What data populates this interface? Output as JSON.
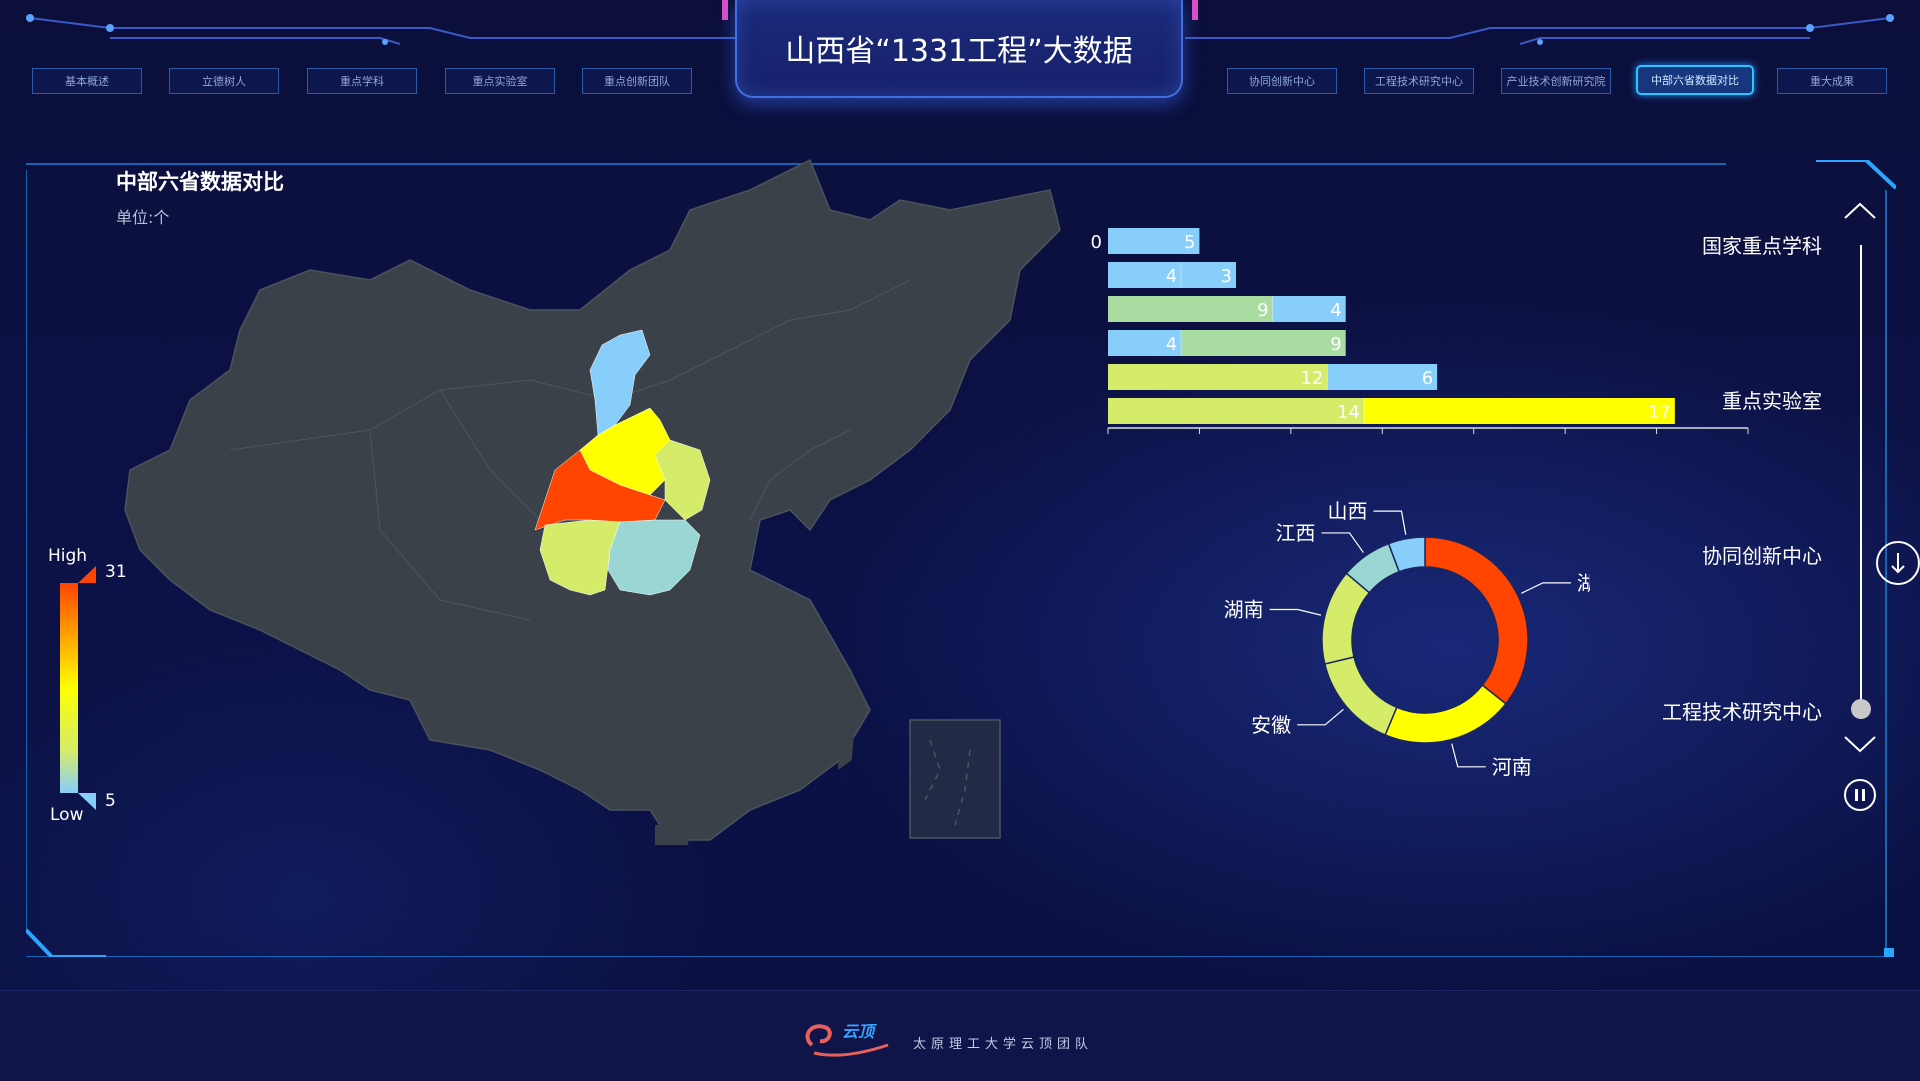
{
  "header": {
    "title": "山西省“1331工程”大数据",
    "nav_left": [
      "基本概述",
      "立德树人",
      "重点学科",
      "重点实验室",
      "重点创新团队"
    ],
    "nav_right": [
      "协同创新中心",
      "工程技术研究中心",
      "产业技术创新研究院",
      "中部六省数据对比",
      "重大成果"
    ],
    "active_tab": "中部六省数据对比"
  },
  "panel": {
    "title": "中部六省数据对比",
    "unit": "单位:个"
  },
  "map": {
    "legend": {
      "high_label": "High",
      "low_label": "Low",
      "max": "31",
      "min": "5"
    },
    "provinces": [
      {
        "name": "山西",
        "color": "#87cefa"
      },
      {
        "name": "河南",
        "color": "#ffff00"
      },
      {
        "name": "湖北",
        "color": "#ff4500"
      },
      {
        "name": "安徽",
        "color": "#d4ec6a"
      },
      {
        "name": "湖南",
        "color": "#d4ec6a"
      },
      {
        "name": "江西",
        "color": "#99d6d4"
      }
    ]
  },
  "side_nav": {
    "items": [
      "国家重点学科",
      "重点实验室",
      "协同创新中心",
      "工程技术研究中心"
    ],
    "active_index": 3
  },
  "chart_data": [
    {
      "type": "bar",
      "orientation": "horizontal",
      "stacked": true,
      "rows": [
        {
          "a": 0,
          "b": 5,
          "color_a": "#87cefa",
          "color_b": "#87cefa"
        },
        {
          "a": 4,
          "b": 3,
          "color_a": "#87cefa",
          "color_b": "#87cefa"
        },
        {
          "a": 9,
          "b": 4,
          "color_a": "#a8dca0",
          "color_b": "#87cefa"
        },
        {
          "a": 4,
          "b": 9,
          "color_a": "#87cefa",
          "color_b": "#a8dca0"
        },
        {
          "a": 12,
          "b": 6,
          "color_a": "#d4ec6a",
          "color_b": "#87cefa"
        },
        {
          "a": 14,
          "b": 17,
          "color_a": "#d4ec6a",
          "color_b": "#ffff00"
        }
      ],
      "xlim": [
        0,
        35
      ]
    },
    {
      "type": "pie",
      "donut": true,
      "slices": [
        {
          "label": "湖北",
          "value": 31,
          "color": "#ff4500"
        },
        {
          "label": "河南",
          "value": 18,
          "color": "#ffff00"
        },
        {
          "label": "安徽",
          "value": 13,
          "color": "#d4ec6a"
        },
        {
          "label": "湖南",
          "value": 13,
          "color": "#d4ec6a"
        },
        {
          "label": "江西",
          "value": 7,
          "color": "#99d6d4"
        },
        {
          "label": "山西",
          "value": 5,
          "color": "#87cefa"
        }
      ]
    }
  ],
  "footer": {
    "logo_text": "云顶",
    "text": "太原理工大学云顶团队"
  }
}
